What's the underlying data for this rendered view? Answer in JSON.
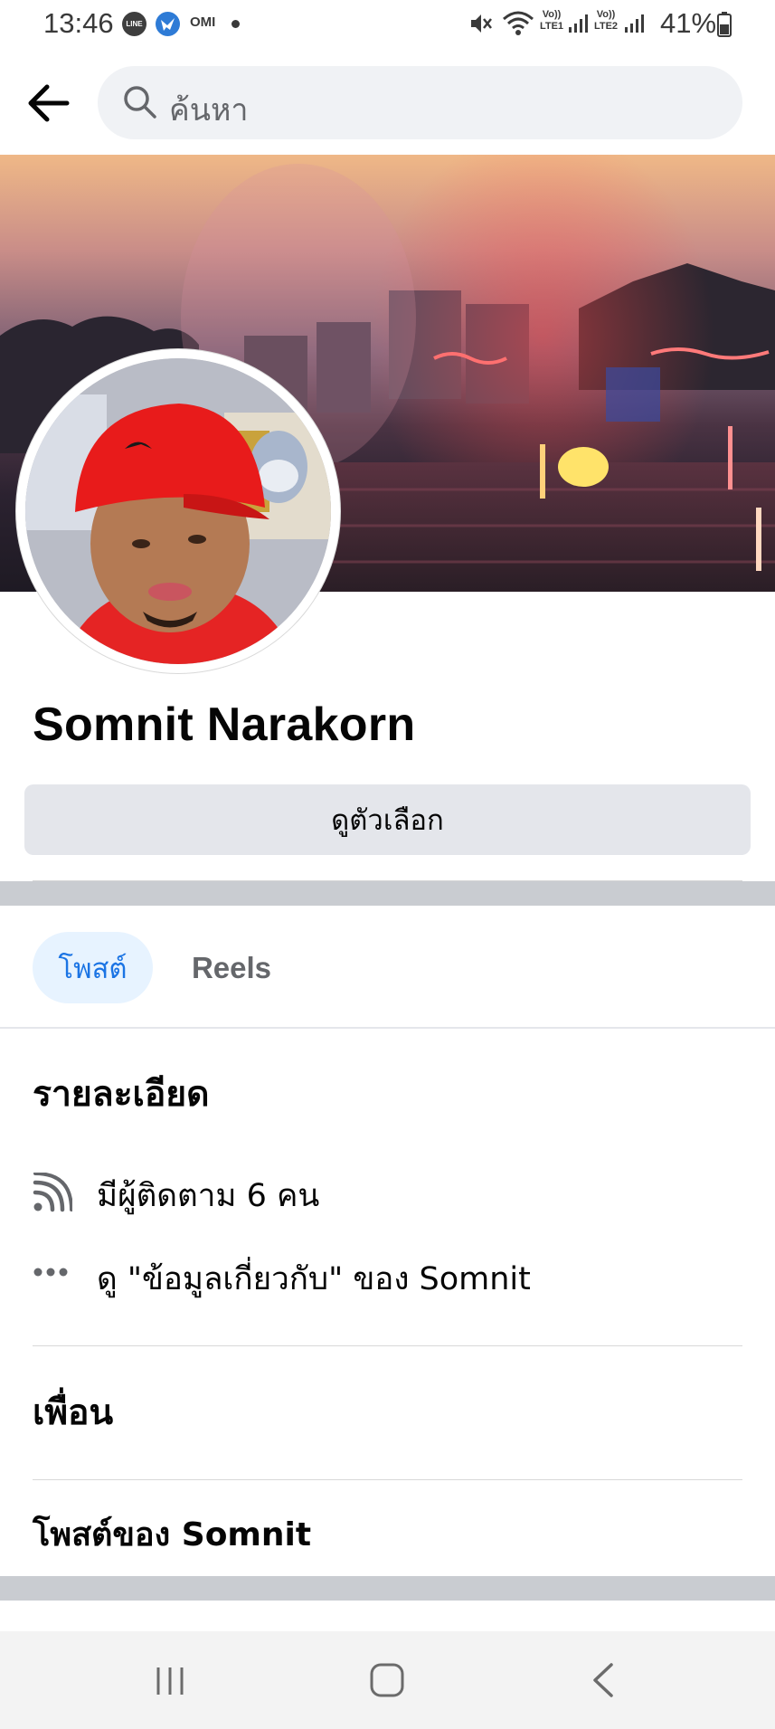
{
  "status_bar": {
    "time": "13:46",
    "omi_label": "OMI",
    "line_label": "LINE",
    "battery_percent": "41%",
    "sim1_label": "LTE1",
    "sim2_label": "LTE2",
    "volte_label": "Vo))"
  },
  "header": {
    "search_placeholder": "ค้นหา"
  },
  "profile": {
    "name": "Somnit Narakorn",
    "options_button": "ดูตัวเลือก"
  },
  "tabs": [
    {
      "label": "โพสต์",
      "active": true
    },
    {
      "label": "Reels",
      "active": false
    }
  ],
  "details": {
    "title": "รายละเอียด",
    "followers": "มีผู้ติดตาม 6 คน",
    "about": "ดู \"ข้อมูลเกี่ยวกับ\" ของ Somnit"
  },
  "friends": {
    "title": "เพื่อน"
  },
  "posts": {
    "title": "โพสต์ของ Somnit"
  },
  "colors": {
    "accent": "#1b74e4",
    "tab_active_bg": "#e7f3ff",
    "button_bg": "#e4e6eb",
    "divider": "#c9ccd1"
  }
}
